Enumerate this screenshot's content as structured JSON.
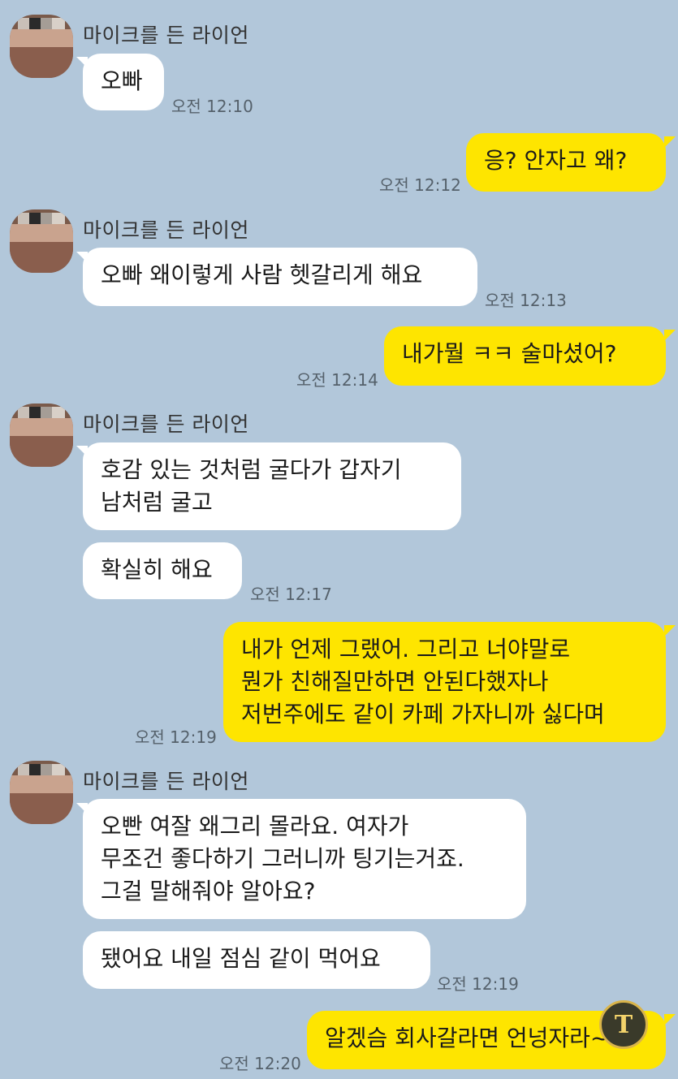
{
  "contact": {
    "name": "마이크를 든 라이언"
  },
  "messages": [
    {
      "side": "in",
      "text": "오빠",
      "time": "오전 12:10"
    },
    {
      "side": "out",
      "text": "응? 안자고 왜?",
      "time": "오전 12:12"
    },
    {
      "side": "in",
      "text": "오빠 왜이렇게 사람 헷갈리게 해요",
      "time": "오전 12:13"
    },
    {
      "side": "out",
      "text": "내가뭘 ㅋㅋ 술마셨어?",
      "time": "오전 12:14"
    },
    {
      "side": "in",
      "text": "호감 있는 것처럼 굴다가 갑자기\n남처럼 굴고",
      "time": ""
    },
    {
      "side": "in",
      "text": "확실히 해요",
      "time": "오전 12:17"
    },
    {
      "side": "out",
      "text": "내가 언제 그랬어. 그리고 너야말로\n뭔가 친해질만하면 안된다했자나\n저번주에도 같이 카페 가자니까 싫다며",
      "time": "오전 12:19"
    },
    {
      "side": "in",
      "text": "오빤 여잘 왜그리 몰라요. 여자가\n무조건 좋다하기 그러니까 팅기는거죠.\n그걸 말해줘야 알아요?",
      "time": ""
    },
    {
      "side": "in",
      "text": "됐어요 내일 점심 같이 먹어요",
      "time": "오전 12:19"
    },
    {
      "side": "out",
      "text": "알겠슴 회사갈라면 언넝자라~",
      "time": "오전 12:20"
    }
  ],
  "colors": {
    "background": "#b2c7da",
    "incoming_bubble": "#ffffff",
    "outgoing_bubble": "#fee500"
  },
  "overlay_icon": "text-recognition-app-icon"
}
